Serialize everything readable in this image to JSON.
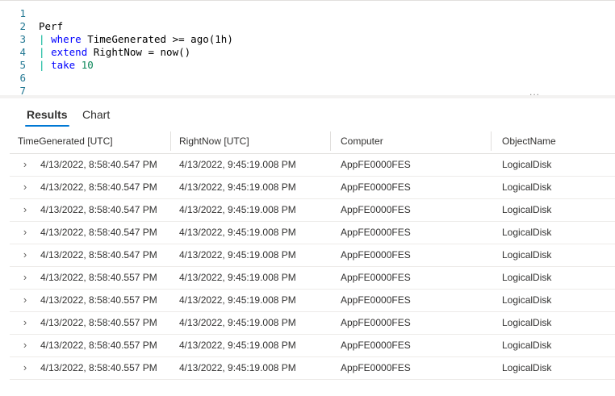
{
  "editor": {
    "lines": [
      {
        "num": "1",
        "tokens": []
      },
      {
        "num": "2",
        "tokens": [
          {
            "t": "Perf",
            "c": "plain"
          }
        ]
      },
      {
        "num": "3",
        "tokens": [
          {
            "t": "| ",
            "c": "pipe"
          },
          {
            "t": "where",
            "c": "kw"
          },
          {
            "t": " TimeGenerated >= ago(1h)",
            "c": "plain"
          }
        ]
      },
      {
        "num": "4",
        "tokens": [
          {
            "t": "| ",
            "c": "pipe"
          },
          {
            "t": "extend",
            "c": "kw"
          },
          {
            "t": " RightNow = now()",
            "c": "plain"
          }
        ]
      },
      {
        "num": "5",
        "tokens": [
          {
            "t": "| ",
            "c": "pipe"
          },
          {
            "t": "take",
            "c": "kw"
          },
          {
            "t": " ",
            "c": "plain"
          },
          {
            "t": "10",
            "c": "num"
          }
        ]
      },
      {
        "num": "6",
        "tokens": []
      },
      {
        "num": "7",
        "tokens": []
      }
    ],
    "more_label": "..."
  },
  "tabs": [
    {
      "label": "Results",
      "active": true
    },
    {
      "label": "Chart",
      "active": false
    }
  ],
  "table": {
    "columns": [
      "TimeGenerated [UTC]",
      "RightNow [UTC]",
      "Computer",
      "ObjectName"
    ],
    "rows": [
      [
        "4/13/2022, 8:58:40.547 PM",
        "4/13/2022, 9:45:19.008 PM",
        "AppFE0000FES",
        "LogicalDisk"
      ],
      [
        "4/13/2022, 8:58:40.547 PM",
        "4/13/2022, 9:45:19.008 PM",
        "AppFE0000FES",
        "LogicalDisk"
      ],
      [
        "4/13/2022, 8:58:40.547 PM",
        "4/13/2022, 9:45:19.008 PM",
        "AppFE0000FES",
        "LogicalDisk"
      ],
      [
        "4/13/2022, 8:58:40.547 PM",
        "4/13/2022, 9:45:19.008 PM",
        "AppFE0000FES",
        "LogicalDisk"
      ],
      [
        "4/13/2022, 8:58:40.547 PM",
        "4/13/2022, 9:45:19.008 PM",
        "AppFE0000FES",
        "LogicalDisk"
      ],
      [
        "4/13/2022, 8:58:40.557 PM",
        "4/13/2022, 9:45:19.008 PM",
        "AppFE0000FES",
        "LogicalDisk"
      ],
      [
        "4/13/2022, 8:58:40.557 PM",
        "4/13/2022, 9:45:19.008 PM",
        "AppFE0000FES",
        "LogicalDisk"
      ],
      [
        "4/13/2022, 8:58:40.557 PM",
        "4/13/2022, 9:45:19.008 PM",
        "AppFE0000FES",
        "LogicalDisk"
      ],
      [
        "4/13/2022, 8:58:40.557 PM",
        "4/13/2022, 9:45:19.008 PM",
        "AppFE0000FES",
        "LogicalDisk"
      ],
      [
        "4/13/2022, 8:58:40.557 PM",
        "4/13/2022, 9:45:19.008 PM",
        "AppFE0000FES",
        "LogicalDisk"
      ]
    ],
    "expand_icon": "chevron-right-icon"
  }
}
